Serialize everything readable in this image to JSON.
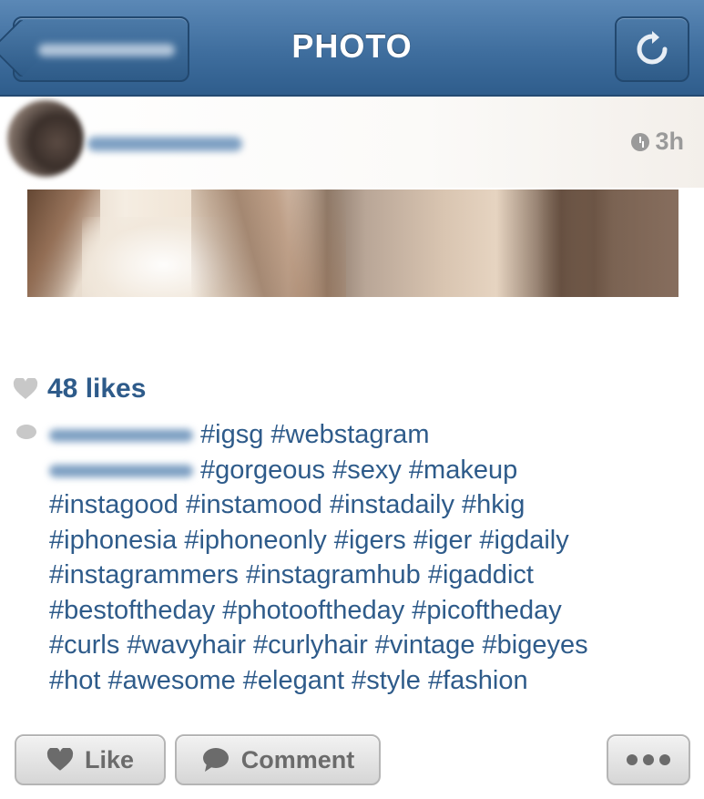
{
  "navbar": {
    "title": "PHOTO"
  },
  "post": {
    "time_ago": "3h",
    "likes_text": "48 likes",
    "caption_lines": [
      "#igsg #webstagram",
      "#gorgeous #sexy #makeup",
      "#instagood #instamood #instadaily #hkig",
      "#iphonesia #iphoneonly #igers #iger #igdaily",
      "#instagrammers #instagramhub #igaddict",
      "#bestoftheday #photooftheday #picoftheday",
      "#curls #wavyhair #curlyhair #vintage #bigeyes",
      "#hot #awesome #elegant #style #fashion"
    ]
  },
  "actions": {
    "like_label": "Like",
    "comment_label": "Comment"
  },
  "colors": {
    "navbar": "#3f6e9e",
    "link": "#2e5b8a",
    "muted": "#9a9a9a"
  },
  "icons": [
    "back-arrow-icon",
    "refresh-icon",
    "clock-icon",
    "heart-icon",
    "comment-bubble-icon",
    "more-dots-icon"
  ]
}
